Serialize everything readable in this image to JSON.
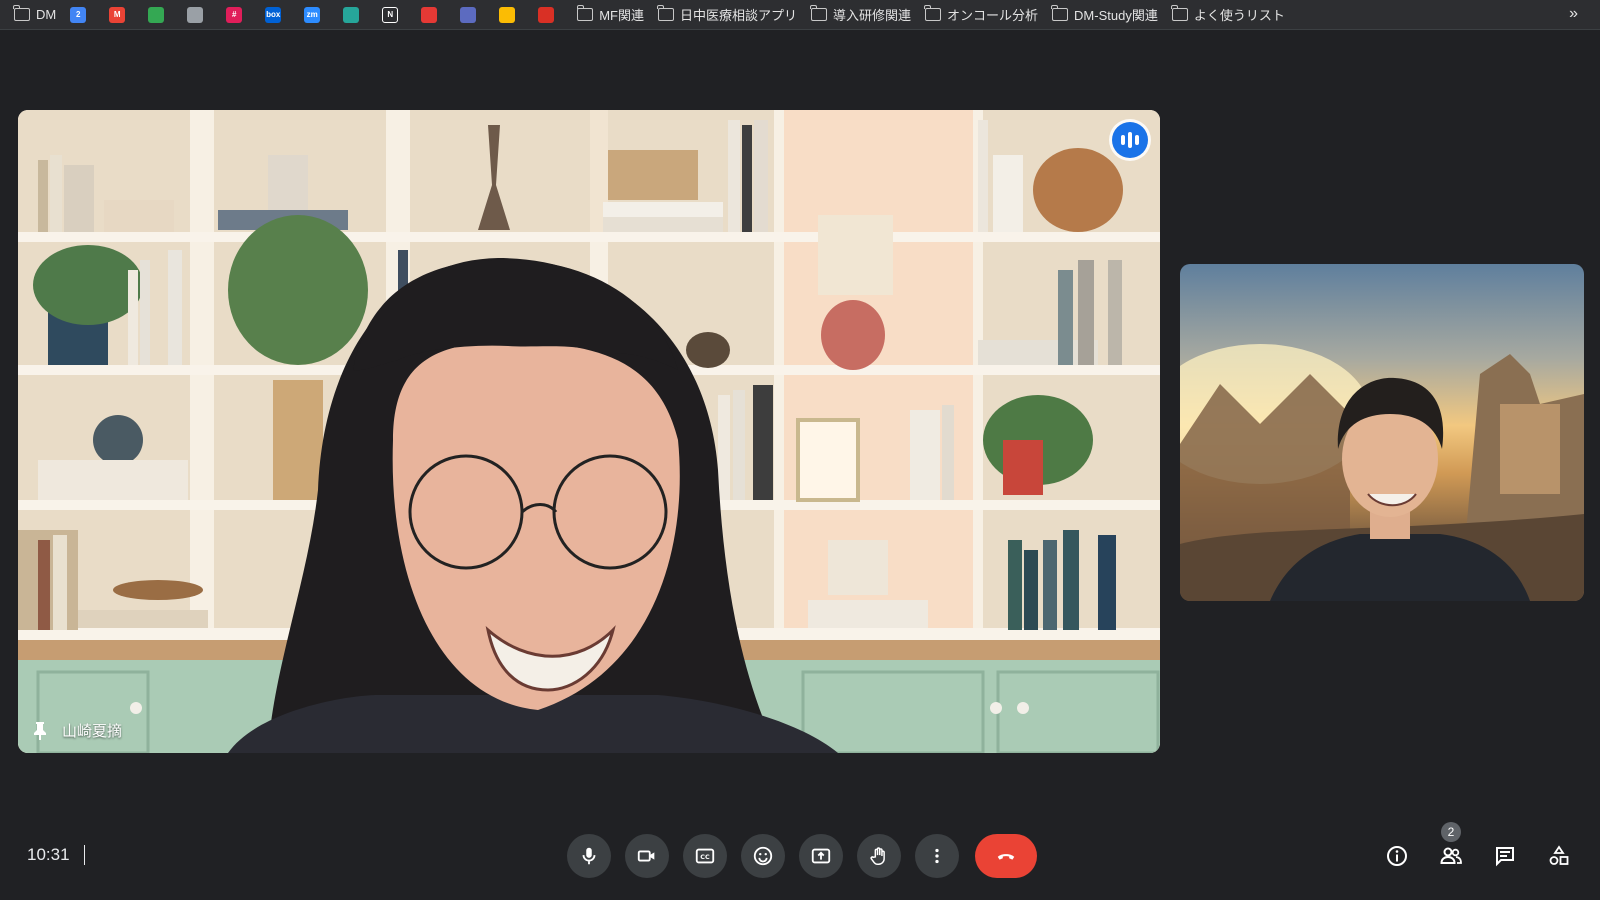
{
  "bookmarks": {
    "items": [
      {
        "label": "DM",
        "icon": "folder-settings-icon"
      },
      {
        "icon": "calendar-app-icon",
        "text": "2",
        "color": "#4285f4"
      },
      {
        "icon": "gmail-icon",
        "text": "M",
        "color": "#ea4335"
      },
      {
        "icon": "drive-icon",
        "text": "",
        "color": "#34a853"
      },
      {
        "icon": "app-icon",
        "text": "",
        "color": "#9aa0a6"
      },
      {
        "icon": "slack-icon",
        "text": "#",
        "color": "#e01e5a"
      },
      {
        "icon": "box-icon",
        "text": "box",
        "color": "#0061d5"
      },
      {
        "icon": "zoom-icon",
        "text": "zm",
        "color": "#2d8cff"
      },
      {
        "icon": "app-icon",
        "text": "",
        "color": "#26a69a"
      },
      {
        "icon": "notion-icon",
        "text": "N",
        "color": "#ffffff"
      },
      {
        "icon": "app-icon",
        "text": "",
        "color": "#e53935"
      },
      {
        "icon": "app-icon",
        "text": "",
        "color": "#5c6bc0"
      },
      {
        "icon": "app-icon",
        "text": "",
        "color": "#fbbc04"
      },
      {
        "icon": "app-icon",
        "text": "",
        "color": "#d93025"
      }
    ],
    "folders": [
      {
        "label": "MF関連"
      },
      {
        "label": "日中医療相談アプリ"
      },
      {
        "label": "導入研修関連"
      },
      {
        "label": "オンコール分析"
      },
      {
        "label": "DM-Study関連"
      },
      {
        "label": "よく使うリスト"
      }
    ],
    "more": "»"
  },
  "main_tile": {
    "participant_name": "山崎夏摘",
    "speaking_icon": "speaking-indicator-icon",
    "pin_icon": "pin-icon"
  },
  "controls": {
    "time": "10:31",
    "buttons": [
      "mic-icon",
      "camera-icon",
      "captions-icon",
      "emoji-icon",
      "present-icon",
      "raise-hand-icon",
      "more-icon",
      "end-call-icon"
    ],
    "end_call_color": "#ea4335"
  },
  "right_tools": {
    "people_count": "2",
    "icons": [
      "info-icon",
      "people-icon",
      "chat-icon",
      "activities-icon"
    ]
  },
  "colors": {
    "background": "#202124",
    "accent": "#1a73e8"
  }
}
